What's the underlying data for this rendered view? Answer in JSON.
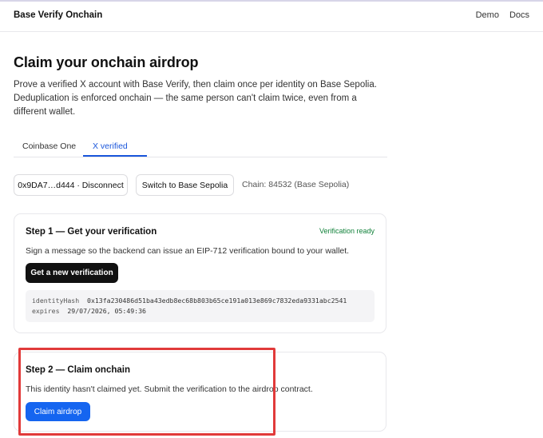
{
  "header": {
    "brand": "Base Verify Onchain",
    "nav": [
      "Demo",
      "Docs"
    ]
  },
  "page": {
    "title": "Claim your onchain airdrop",
    "intro": "Prove a verified X account with Base Verify, then claim once per identity on Base Sepolia. Deduplication is enforced onchain — the same person can't claim twice, even from a different wallet."
  },
  "tabs": [
    {
      "label": "Coinbase One",
      "active": false
    },
    {
      "label": "X verified",
      "active": true
    }
  ],
  "wallet": {
    "disconnect_label": "0x9DA7…d444 · Disconnect",
    "switch_label": "Switch to Base Sepolia",
    "chain_label": "Chain: 84532 (Base Sepolia)"
  },
  "step1": {
    "title": "Step 1 — Get your verification",
    "badge": "Verification ready",
    "description": "Sign a message so the backend can issue an EIP-712 verification bound to your wallet.",
    "button_label": "Get a new verification",
    "identity_key": "identityHash",
    "identity_value": "0x13fa230486d51ba43edb8ec68b803b65ce191a013e869c7832eda9331abc2541",
    "expires_key": "expires",
    "expires_value": "29/07/2026, 05:49:36"
  },
  "step2": {
    "title": "Step 2 — Claim onchain",
    "description": "This identity hasn't claimed yet. Submit the verification to the airdrop contract.",
    "button_label": "Claim airdrop"
  },
  "colors": {
    "accent_blue": "#1565f0",
    "tab_active": "#1a56db",
    "ready_green": "#12823b",
    "highlight_red": "#e13a3a"
  }
}
